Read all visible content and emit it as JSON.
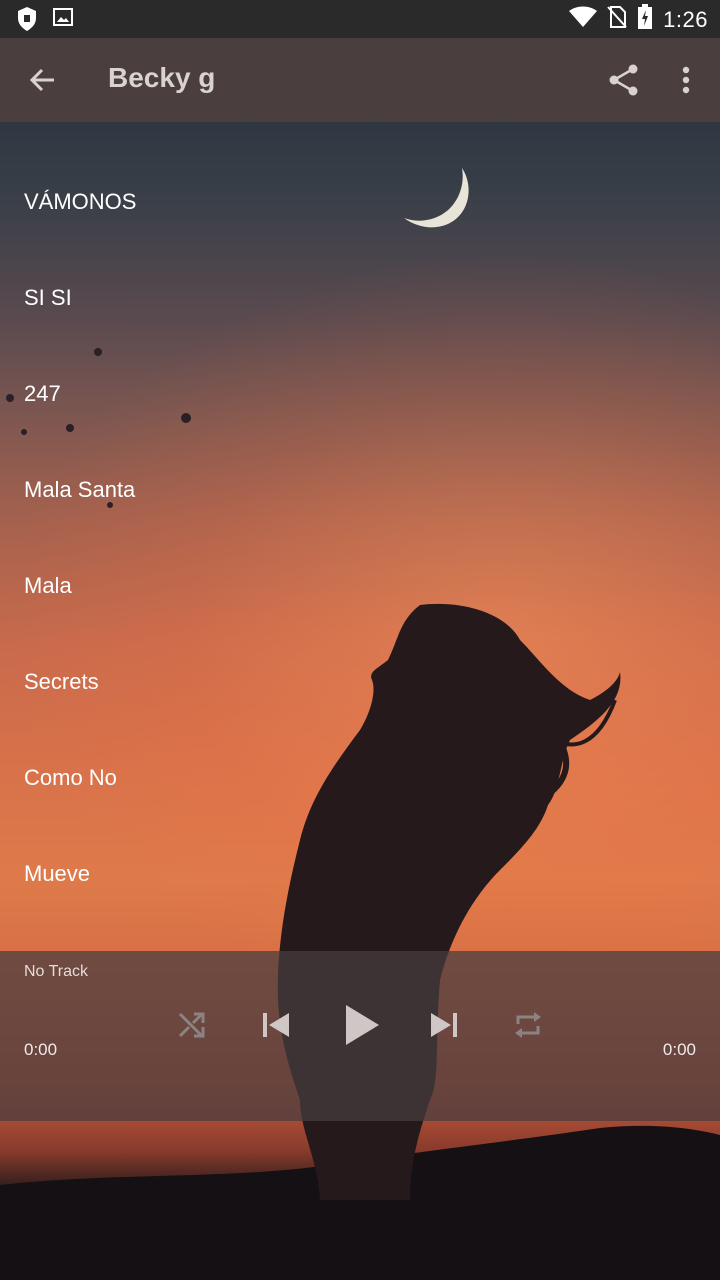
{
  "status_bar": {
    "time": "1:26",
    "icons": [
      "shield-icon",
      "image-icon",
      "wifi-icon",
      "no-sim-icon",
      "battery-icon"
    ]
  },
  "app_bar": {
    "title": "Becky g",
    "back_icon": "arrow-left-icon",
    "share_icon": "share-icon",
    "more_icon": "more-vert-icon"
  },
  "tracks": [
    {
      "title": "VÁMONOS"
    },
    {
      "title": "SI SI"
    },
    {
      "title": "247"
    },
    {
      "title": "Mala Santa"
    },
    {
      "title": "Mala"
    },
    {
      "title": "Secrets"
    },
    {
      "title": "Como No"
    },
    {
      "title": "Mueve"
    }
  ],
  "player": {
    "now_playing": "No Track",
    "elapsed": "0:00",
    "duration": "0:00",
    "controls": [
      "shuffle-icon",
      "skip-previous-icon",
      "play-icon",
      "skip-next-icon",
      "repeat-icon"
    ]
  },
  "colors": {
    "app_bar": "#4a3e3e",
    "status_bar": "#2b2a2a",
    "player_panel": "#463c3e",
    "accent_sky": "#de7a4a"
  }
}
